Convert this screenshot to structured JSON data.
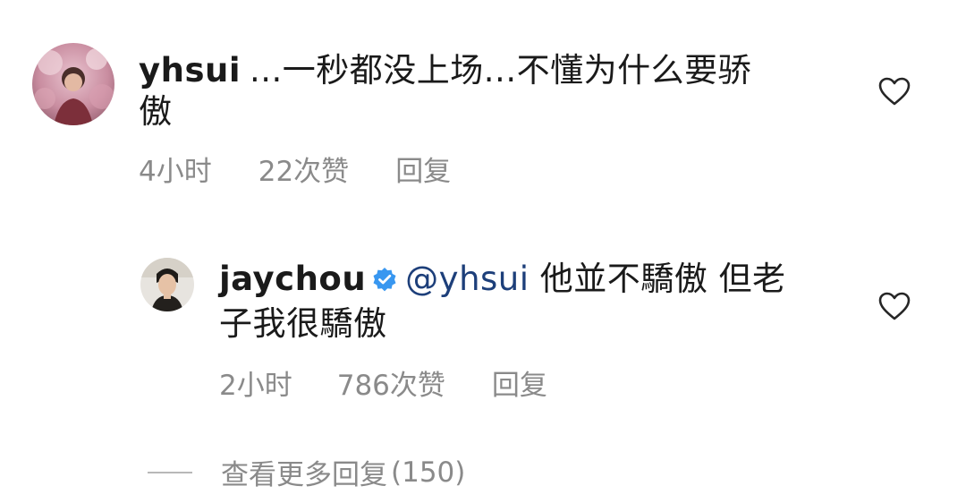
{
  "comment": {
    "username": "yhsui",
    "text_line1": "...一秒都没上场...不懂为什么要骄",
    "text_line2": "傲",
    "time": "4小时",
    "likes": "22次赞",
    "reply": "回复",
    "like_icon": "heart-outline-icon"
  },
  "reply": {
    "username": "jaychou",
    "verified_icon": "verified-badge-icon",
    "verified_color": "#3897f0",
    "mention": "@yhsui",
    "text_line1": " 他並不驕傲 但老",
    "text_line2": "子我很驕傲",
    "time": "2小时",
    "likes": "786次赞",
    "reply": "回复",
    "like_icon": "heart-outline-icon"
  },
  "view_more": {
    "label": "查看更多回复",
    "count": "(150)"
  }
}
